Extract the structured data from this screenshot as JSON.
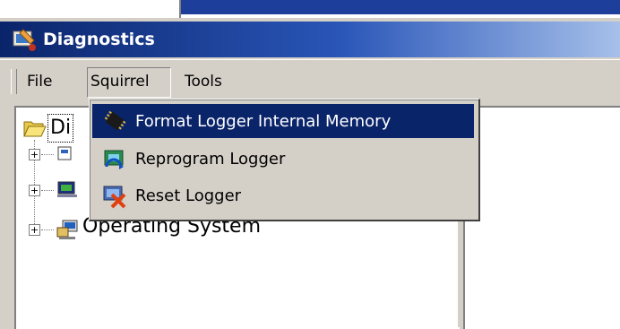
{
  "window": {
    "title": "Diagnostics"
  },
  "menubar": {
    "items": [
      {
        "label": "File"
      },
      {
        "label": "Squirrel"
      },
      {
        "label": "Tools"
      }
    ]
  },
  "dropdown": {
    "items": [
      {
        "label": "Format Logger Internal Memory",
        "icon": "memory-chip-icon",
        "highlighted": true
      },
      {
        "label": "Reprogram Logger",
        "icon": "reprogram-logger-icon"
      },
      {
        "label": "Reset Logger",
        "icon": "reset-logger-icon"
      }
    ]
  },
  "tree": {
    "root_label": "Di",
    "visible_node": "Operating System"
  },
  "colors": {
    "title_bar": "#0a246a",
    "highlight": "#0a246a",
    "face": "#d4d0c8"
  }
}
